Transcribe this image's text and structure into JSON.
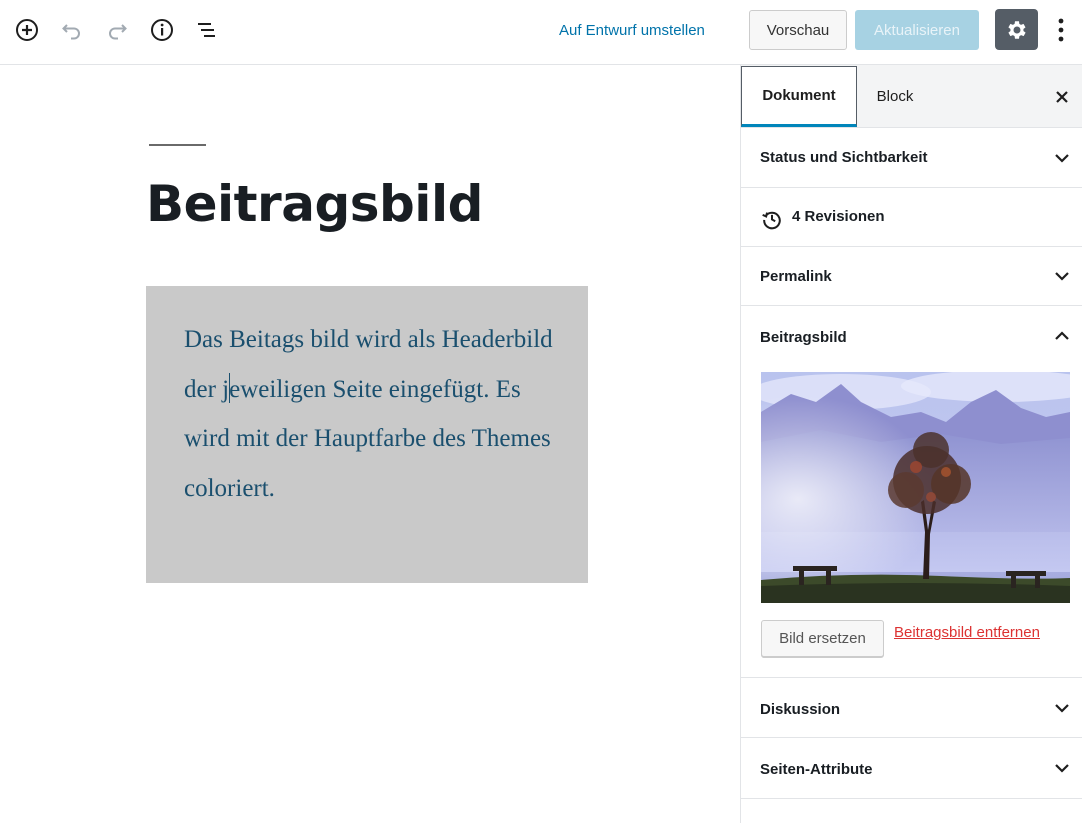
{
  "toolbar": {
    "add_block_icon": "plus-circle-icon",
    "undo_icon": "undo-icon",
    "redo_icon": "redo-icon",
    "info_icon": "info-icon",
    "outline_icon": "list-outline-icon",
    "draft_link": "Auf Entwurf umstellen",
    "preview_label": "Vorschau",
    "update_label": "Aktualisieren",
    "settings_icon": "gear-icon",
    "more_icon": "vertical-ellipsis-icon"
  },
  "editor": {
    "title": "Beitragsbild",
    "paragraph": {
      "before_caret": "Das Beitags bild wird als Headerbild der j",
      "after_caret": "eweiligen Seite eingefügt. Es wird mit der Hauptfarbe des Themes coloriert."
    }
  },
  "sidebar": {
    "tabs": [
      {
        "label": "Dokument",
        "active": true
      },
      {
        "label": "Block",
        "active": false
      }
    ],
    "close_icon": "close-icon",
    "panels": {
      "status": "Status und Sichtbarkeit",
      "revisions": "4 Revisionen",
      "permalink": "Permalink",
      "featured_image": "Beitragsbild",
      "discussion": "Diskussion",
      "page_attributes": "Seiten-Attribute"
    },
    "featured_image": {
      "replace_label": "Bild ersetzen",
      "remove_label": "Beitragsbild entfernen"
    }
  },
  "colors": {
    "accent": "#0073aa",
    "update_disabled": "#a7d2e3",
    "settings_bg": "#555d66",
    "paragraph_bg": "#c9c9c9",
    "paragraph_text": "#1a4f6e",
    "remove_link": "#dc3232"
  }
}
